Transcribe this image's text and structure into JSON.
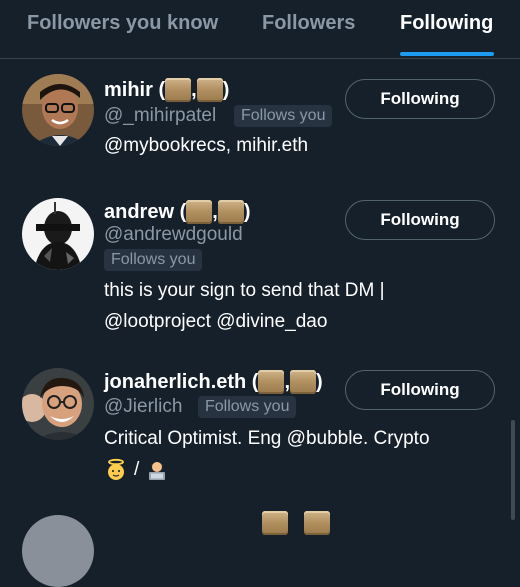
{
  "tabs": [
    {
      "label": "Followers you know",
      "active": false
    },
    {
      "label": "Followers",
      "active": false
    },
    {
      "label": "Following",
      "active": true
    }
  ],
  "colors": {
    "background": "#15202b",
    "accent": "#1d9bf0",
    "secondary_text": "#8b98a5",
    "border": "#38444d"
  },
  "users": [
    {
      "name": "mihir (",
      "name_sep": ",",
      "name_end": ")",
      "name_emojis": [
        "scroll-emoji",
        "scroll-emoji"
      ],
      "handle": "@_mihirpatel",
      "follows_you": "Follows you",
      "bio": "@mybookrecs, mihir.eth",
      "button_label": "Following"
    },
    {
      "name": "andrew (",
      "name_sep": ",",
      "name_end": ")",
      "name_emojis": [
        "scroll-emoji",
        "scroll-emoji"
      ],
      "handle": "@andrewdgould",
      "follows_you": "Follows you",
      "bio_line1": "this is your sign to send that DM |",
      "bio_line2": "@lootproject @divine_dao",
      "button_label": "Following"
    },
    {
      "name": "jonaherlich.eth (",
      "name_sep": ",",
      "name_end": ")",
      "name_emojis": [
        "scroll-emoji",
        "scroll-emoji"
      ],
      "handle": "@Jierlich",
      "follows_you": "Follows you",
      "bio_line1": "Critical Optimist. Eng @bubble. Crypto",
      "bio_emojis": [
        "baby-angel-emoji",
        "technologist-emoji"
      ],
      "bio_line2_sep": "/",
      "button_label": "Following"
    }
  ]
}
